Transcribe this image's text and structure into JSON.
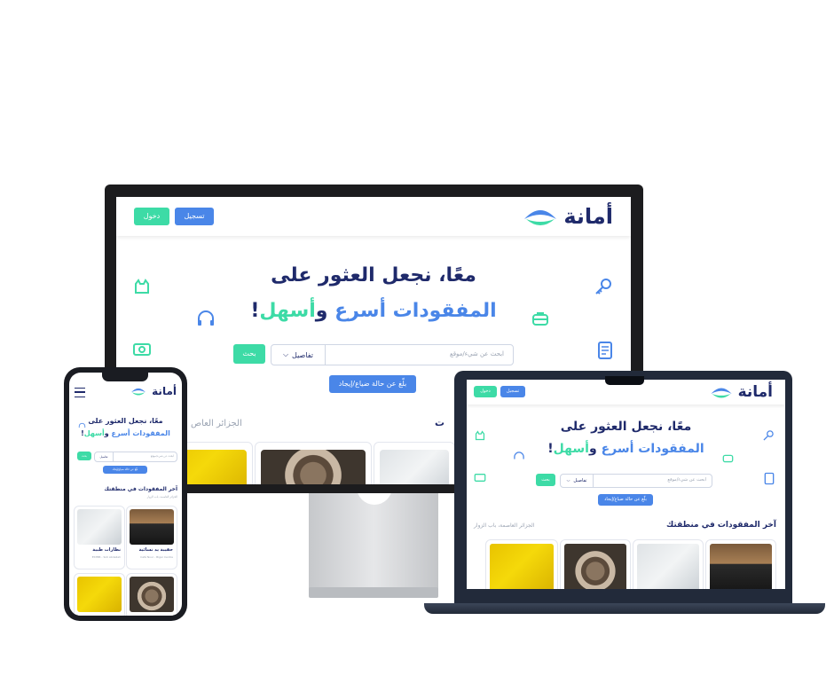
{
  "app": {
    "logo_text": "أمانة",
    "login_label": "دخول",
    "register_label": "تسجيل"
  },
  "hero": {
    "line1": "معًا، نجعل العثور على",
    "line2_part1": "المفقودات",
    "line2_part2": "أسرع",
    "line2_part3": "و",
    "line2_part4": "أسهل",
    "line2_part5": "!"
  },
  "search": {
    "placeholder": "ابحث عن شيء/موقع",
    "select_label": "تفاصيل",
    "search_button": "بحث",
    "report_button": "بلّغ عن حالة ضياع/إيجاد"
  },
  "latest": {
    "title": "آخر المفقودات في منطقتك",
    "location": "الجزائر العاصمة، باب الزوار",
    "location_short": "الجزائر العاص"
  },
  "phone_items": [
    {
      "title": "حقيبة يد نسائية",
      "sub": "Café Nour - Bigar Centre"
    },
    {
      "title": "نظارات طبية",
      "sub": "ESTBB - Sidi Abdellah"
    }
  ],
  "colors": {
    "navy": "#1f2a6b",
    "blue": "#4a86e8",
    "green": "#3ddba6"
  },
  "icons": [
    "key-icon",
    "cat-icon",
    "headphones-icon",
    "briefcase-icon",
    "money-icon",
    "document-icon",
    "menu-icon",
    "chevron-down-icon",
    "logo-mark-icon"
  ]
}
